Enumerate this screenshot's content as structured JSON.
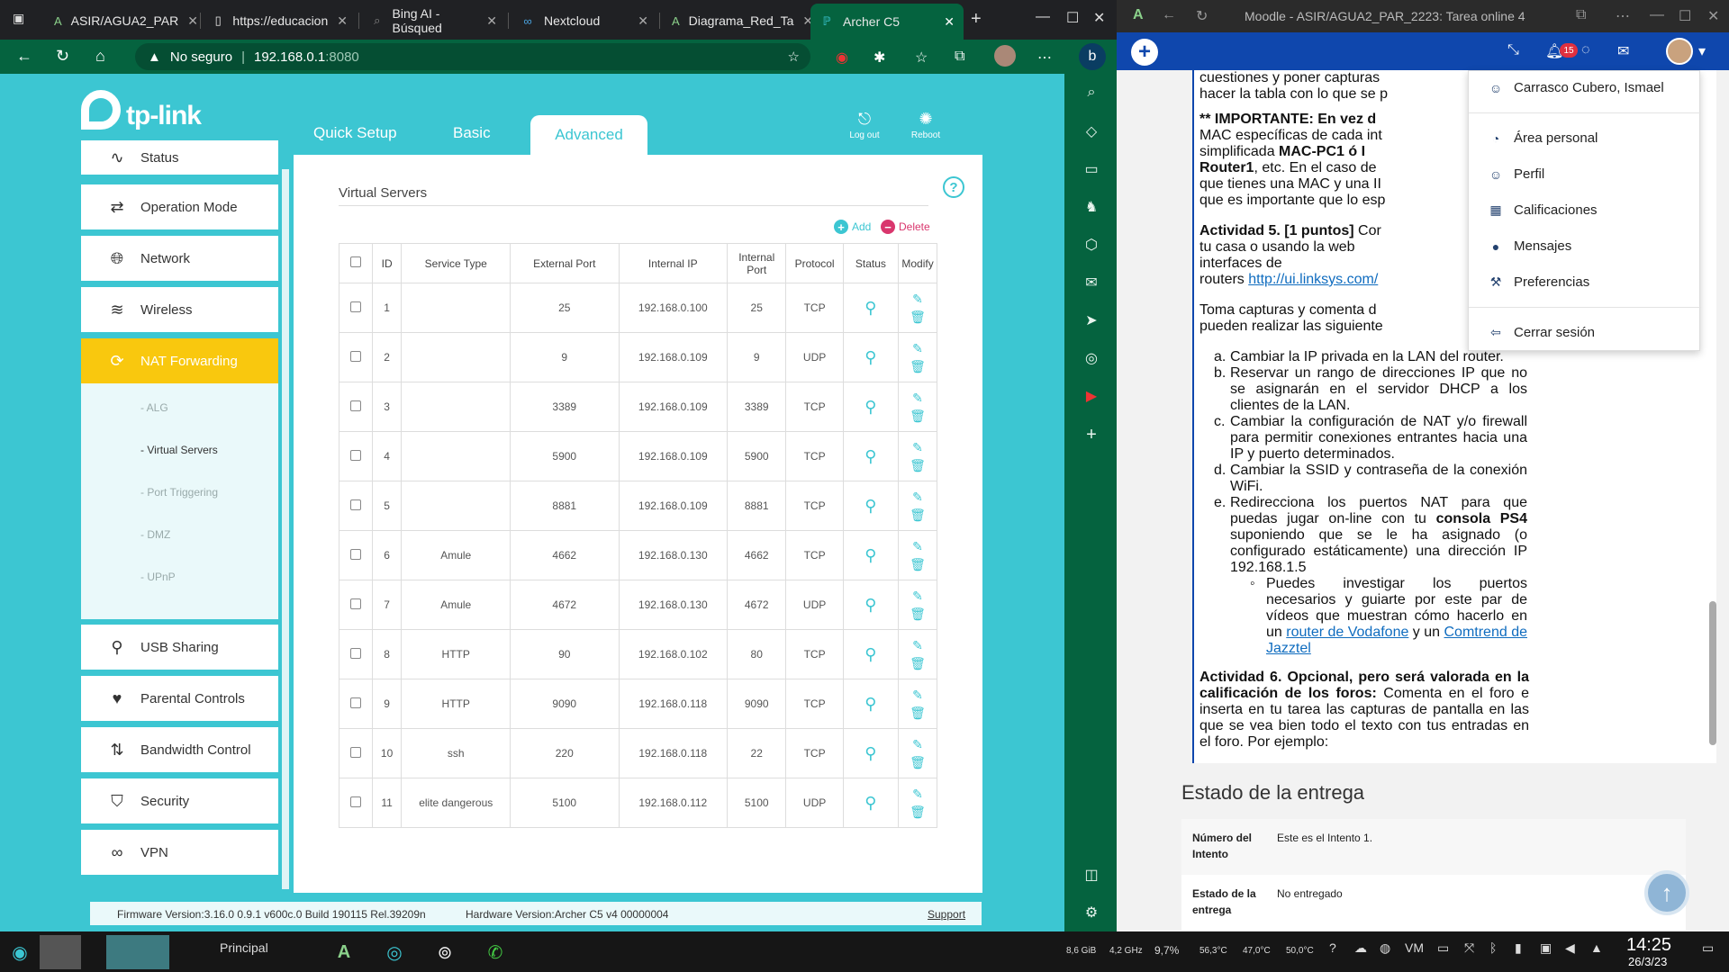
{
  "left_browser": {
    "tabs": [
      {
        "label": "ASIR/AGUA2_PAR",
        "icon": "moodle-icon"
      },
      {
        "label": "https://educacion",
        "icon": "page-icon"
      },
      {
        "label": "Bing AI - Búsqued",
        "icon": "search-icon"
      },
      {
        "label": "Nextcloud",
        "icon": "nextcloud-icon"
      },
      {
        "label": "Diagrama_Red_Ta",
        "icon": "moodle-icon"
      },
      {
        "label": "Archer C5",
        "icon": "tplink-icon",
        "active": true
      }
    ],
    "address": {
      "warning": "No seguro",
      "host": "192.168.0.1",
      "port": ":8080"
    }
  },
  "tplink": {
    "logo": "tp-link",
    "nav": {
      "quick_setup": "Quick Setup",
      "basic": "Basic",
      "advanced": "Advanced",
      "logout": "Log out",
      "reboot": "Reboot"
    },
    "menu": [
      {
        "label": "Status",
        "icon": "pulse-icon"
      },
      {
        "label": "Operation Mode",
        "icon": "swap-icon"
      },
      {
        "label": "Network",
        "icon": "globe-icon"
      },
      {
        "label": "Wireless",
        "icon": "wifi-icon"
      },
      {
        "label": "NAT Forwarding",
        "icon": "nat-icon",
        "active": true
      },
      {
        "label": "USB Sharing",
        "icon": "usb-icon"
      },
      {
        "label": "Parental Controls",
        "icon": "heart-icon"
      },
      {
        "label": "Bandwidth Control",
        "icon": "arrows-icon"
      },
      {
        "label": "Security",
        "icon": "shield-icon"
      },
      {
        "label": "VPN",
        "icon": "link-icon"
      }
    ],
    "submenu": [
      "- ALG",
      "- Virtual Servers",
      "- Port Triggering",
      "- DMZ",
      "- UPnP"
    ],
    "panel_title": "Virtual Servers",
    "add_label": "Add",
    "delete_label": "Delete",
    "table": {
      "headers": [
        "ID",
        "Service Type",
        "External Port",
        "Internal IP",
        "Internal Port",
        "Protocol",
        "Status",
        "Modify"
      ],
      "rows": [
        {
          "id": "1",
          "service": "",
          "ext": "25",
          "ip": "192.168.0.100",
          "int": "25",
          "proto": "TCP"
        },
        {
          "id": "2",
          "service": "",
          "ext": "9",
          "ip": "192.168.0.109",
          "int": "9",
          "proto": "UDP"
        },
        {
          "id": "3",
          "service": "",
          "ext": "3389",
          "ip": "192.168.0.109",
          "int": "3389",
          "proto": "TCP"
        },
        {
          "id": "4",
          "service": "",
          "ext": "5900",
          "ip": "192.168.0.109",
          "int": "5900",
          "proto": "TCP"
        },
        {
          "id": "5",
          "service": "",
          "ext": "8881",
          "ip": "192.168.0.109",
          "int": "8881",
          "proto": "TCP"
        },
        {
          "id": "6",
          "service": "Amule",
          "ext": "4662",
          "ip": "192.168.0.130",
          "int": "4662",
          "proto": "TCP"
        },
        {
          "id": "7",
          "service": "Amule",
          "ext": "4672",
          "ip": "192.168.0.130",
          "int": "4672",
          "proto": "UDP"
        },
        {
          "id": "8",
          "service": "HTTP",
          "ext": "90",
          "ip": "192.168.0.102",
          "int": "80",
          "proto": "TCP"
        },
        {
          "id": "9",
          "service": "HTTP",
          "ext": "9090",
          "ip": "192.168.0.118",
          "int": "9090",
          "proto": "TCP"
        },
        {
          "id": "10",
          "service": "ssh",
          "ext": "220",
          "ip": "192.168.0.118",
          "int": "22",
          "proto": "TCP"
        },
        {
          "id": "11",
          "service": "elite dangerous",
          "ext": "5100",
          "ip": "192.168.0.112",
          "int": "5100",
          "proto": "UDP"
        }
      ]
    },
    "footer": {
      "firmware": "Firmware Version:3.16.0 0.9.1 v600c.0 Build 190115 Rel.39209n",
      "hardware": "Hardware Version:Archer C5 v4 00000004",
      "support": "Support"
    },
    "colors": {
      "accent": "#3cc6d2",
      "active_menu": "#f9c80e"
    }
  },
  "right_browser": {
    "title": "Moodle - ASIR/AGUA2_PAR_2223: Tarea online 4",
    "notification_count": "15",
    "content": {
      "p1_a": "cuestiones y poner capturas",
      "p1_b": "hacer la tabla con lo que se p",
      "p2": [
        "** IMPORTANTE: En vez d",
        "MAC específicas de cada int",
        "simplificada ",
        "MAC-PC1 ó I",
        "Router1",
        ", etc. En el caso de",
        "que tienes una MAC y una II",
        "que es importante que lo esp"
      ],
      "act5_title": "Actividad 5. [1 puntos]",
      "act5_a": " Cor",
      "act5_b": "tu casa o usando la web",
      "act5_c": "interfaces de",
      "act5_d": "routers ",
      "act5_link": "http://ui.linksys.com/",
      "p3_a": "Toma capturas y comenta d",
      "p3_b": "pueden realizar las siguiente",
      "list": [
        {
          "m": "a.",
          "t": "Cambiar la IP privada en la LAN del router."
        },
        {
          "m": "b.",
          "t": "Reservar un rango de direcciones IP que no se asignarán en el servidor DHCP a los clientes de la LAN."
        },
        {
          "m": "c.",
          "t": "Cambiar la configuración de NAT y/o firewall para permitir conexiones entrantes hacia una IP y puerto determinados."
        },
        {
          "m": "d.",
          "t": "Cambiar la SSID y contraseña de la conexión WiFi."
        }
      ],
      "item_e_1": "Redirecciona los puertos NAT para que puedas jugar on-line con tu ",
      "item_e_bold": "consola PS4",
      "item_e_2": " suponiendo que se le ha asignado (o configurado estáticamente) una dirección IP 192.168.1.5",
      "sub_1": "Puedes investigar los puertos necesarios y guiarte por este par de vídeos que muestran cómo hacerlo en un ",
      "sub_link1": "router de Vodafone",
      "sub_2": " y un ",
      "sub_link2": "Comtrend de Jazztel",
      "act6_title": "Actividad 6. Opcional, pero será valorada en la calificación de los foros:",
      "act6_text": " Comenta en el foro e inserta en tu tarea las capturas de pantalla en las que se vea bien todo el texto con tus entradas en el foro. Por ejemplo:"
    },
    "estado": {
      "heading": "Estado de la entrega",
      "rows": [
        {
          "k": "Número del Intento",
          "v": "Este es el Intento 1."
        },
        {
          "k": "Estado de la entrega",
          "v": "No entregado"
        }
      ]
    },
    "dropdown": {
      "user": "Carrasco Cubero, Ismael",
      "items": [
        "Área personal",
        "Perfil",
        "Calificaciones",
        "Mensajes",
        "Preferencias"
      ],
      "logout": "Cerrar sesión"
    }
  },
  "taskbar": {
    "workspace": "Principal",
    "stats": {
      "ram": "8,6 GiB",
      "cpu_freq": "4,2 GHz",
      "cpu": "9,7%",
      "t1": "56,3°C",
      "t2": "47,0°C",
      "t3": "50,0°C"
    },
    "time": "14:25",
    "date": "26/3/23"
  }
}
